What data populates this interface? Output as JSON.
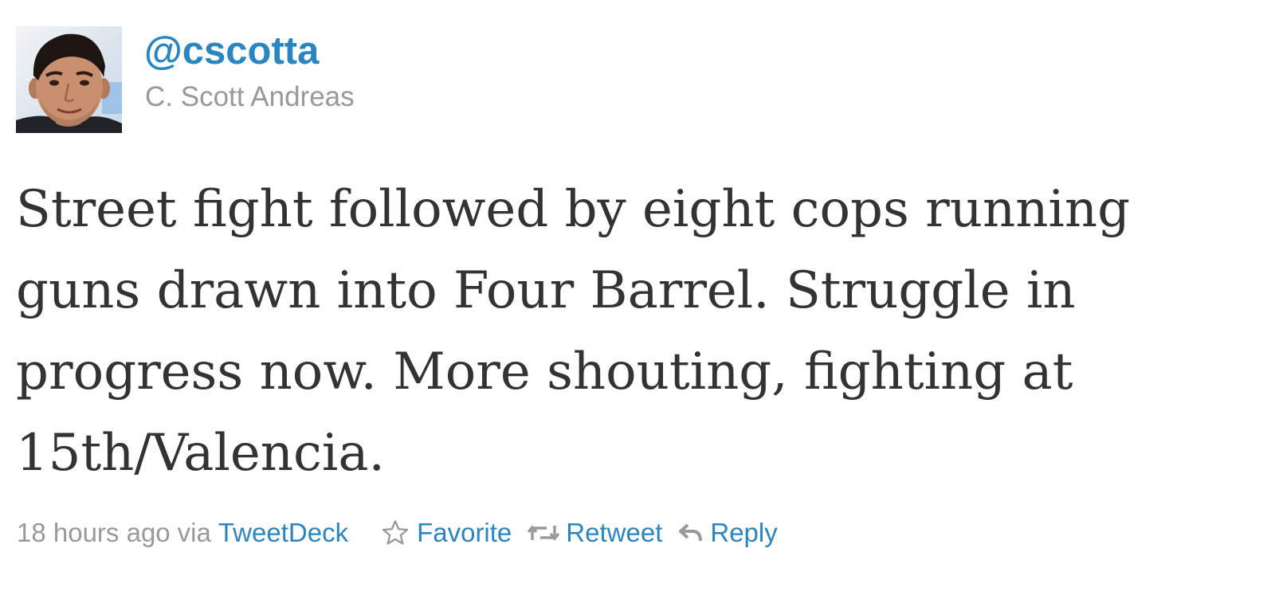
{
  "tweet": {
    "author": {
      "handle": "@cscotta",
      "name": "C. Scott Andreas"
    },
    "text_lines": [
      "Street fight followed by eight cops running",
      "guns drawn into Four Barrel. Struggle in",
      "progress now. More shouting, fighting at",
      "15th/Valencia."
    ],
    "meta": {
      "time": "18 hours ago",
      "via_label": "via",
      "source": "TweetDeck"
    },
    "actions": {
      "favorite": {
        "label": "Favorite",
        "icon": "star-icon"
      },
      "retweet": {
        "label": "Retweet",
        "icon": "retweet-icon"
      },
      "reply": {
        "label": "Reply",
        "icon": "reply-icon"
      }
    },
    "colors": {
      "link": "#2a86c0",
      "muted": "#999999",
      "text": "#333333"
    }
  }
}
